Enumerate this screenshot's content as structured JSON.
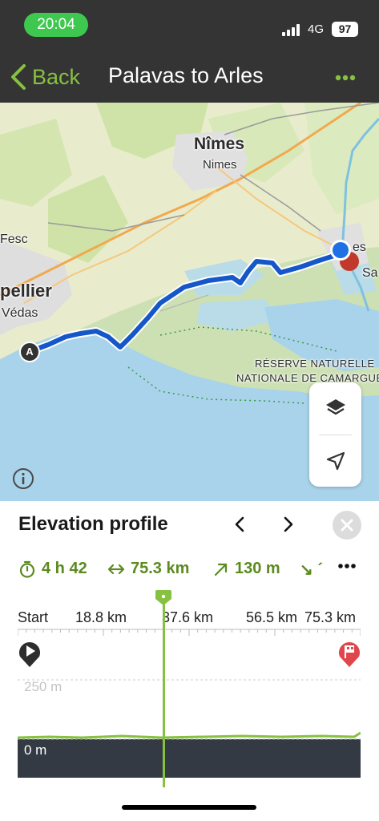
{
  "status_bar": {
    "time": "20:04",
    "network": "4G",
    "battery": "97"
  },
  "nav": {
    "back_label": "Back",
    "title": "Palavas to Arles"
  },
  "map": {
    "labels": {
      "nimes_bold": "Nîmes",
      "nimes": "Nimes",
      "fesc": "Fesc",
      "montpellier": "pellier",
      "vedas": "Védas",
      "arles_partial": "es",
      "sa_partial": "Sa",
      "reserve_line1": "RÉSERVE NATURELLE",
      "reserve_line2": "NATIONALE DE CAMARGUE",
      "start_marker": "A"
    },
    "colors": {
      "route": "#1557c8",
      "water": "#a9d3ea",
      "land": "#e8eccc"
    }
  },
  "elevation": {
    "title": "Elevation profile",
    "stats": {
      "duration": "4 h 42",
      "distance": "75.3 km",
      "ascent": "130 m",
      "descent": "↘ ´"
    },
    "axis_ticks": [
      "Start",
      "18.8 km",
      "37.6 km",
      "56.5 km",
      "75.3 km"
    ],
    "elevation_labels": [
      "250 m",
      "0 m"
    ],
    "accent_color": "#86c13f"
  }
}
